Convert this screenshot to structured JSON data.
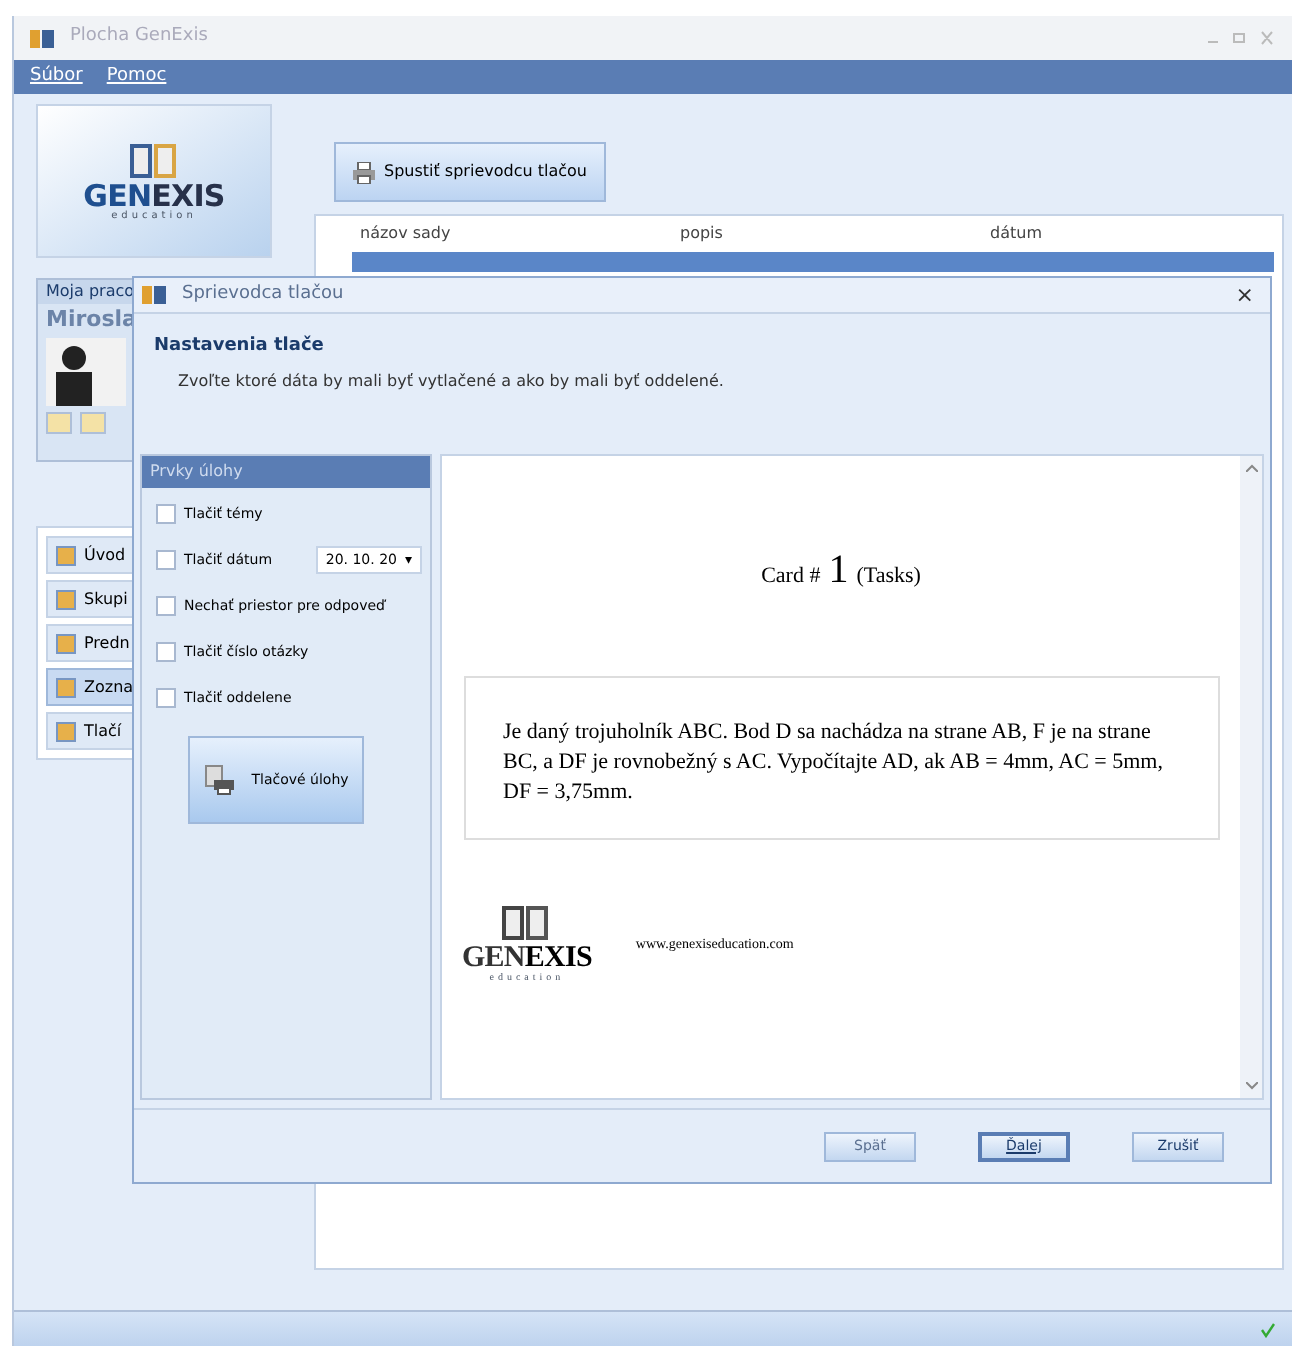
{
  "window": {
    "title": "Plocha GenExis"
  },
  "menu": [
    "Súbor",
    "Pomoc"
  ],
  "logo": {
    "text": "GENEXIS",
    "subtext": "education"
  },
  "wizard_button": "Spustiť sprievodcu tlačou",
  "table": {
    "columns": [
      "názov sady",
      "popis",
      "dátum"
    ]
  },
  "workspace": {
    "title": "Moja praco",
    "user": "Mirosla"
  },
  "nav": [
    {
      "label": "Úvod",
      "selected": false
    },
    {
      "label": "Skupi",
      "selected": false
    },
    {
      "label": "Predn",
      "selected": false
    },
    {
      "label": "Zozna",
      "selected": true
    },
    {
      "label": "Tlačí",
      "selected": false
    }
  ],
  "dialog": {
    "title": "Sprievodca tlačou",
    "heading": "Nastavenia tlače",
    "subtitle": "Zvoľte ktoré dáta by mali byť vytlačené a ako by mali byť oddelené.",
    "panel_title": "Prvky úlohy",
    "options": [
      {
        "kind": "check",
        "label": "Tlačiť témy",
        "checked": false
      },
      {
        "kind": "date",
        "label": "Tlačiť dátum",
        "checked": false,
        "value": "20. 10. 20",
        "caret": "▾"
      },
      {
        "kind": "check",
        "label": "Nechať priestor pre odpoveď",
        "checked": false
      },
      {
        "kind": "check",
        "label": "Tlačiť číslo otázky",
        "checked": false
      },
      {
        "kind": "check",
        "label": "Tlačiť oddelene",
        "checked": false
      }
    ],
    "print_tasks_button": "Tlačové úlohy",
    "preview": {
      "card_prefix": "Card #",
      "card_number": "1",
      "card_suffix": "(Tasks)",
      "task": "Je daný trojuholník ABC. Bod D sa nachádza na strane AB, F je na strane BC, a DF je rovnobežný s AC. Vypočítajte AD, ak AB = 4mm, AC = 5mm, DF = 3,75mm.",
      "logo_text": "GENEXIS",
      "logo_subtext": "education",
      "url": "www.genexiseducation.com"
    },
    "buttons": [
      {
        "label": "Späť",
        "disabled": true,
        "selected": false
      },
      {
        "label": "Ďalej",
        "disabled": false,
        "selected": true
      },
      {
        "label": "Zrušiť",
        "disabled": false,
        "selected": false
      }
    ],
    "close": "×"
  }
}
